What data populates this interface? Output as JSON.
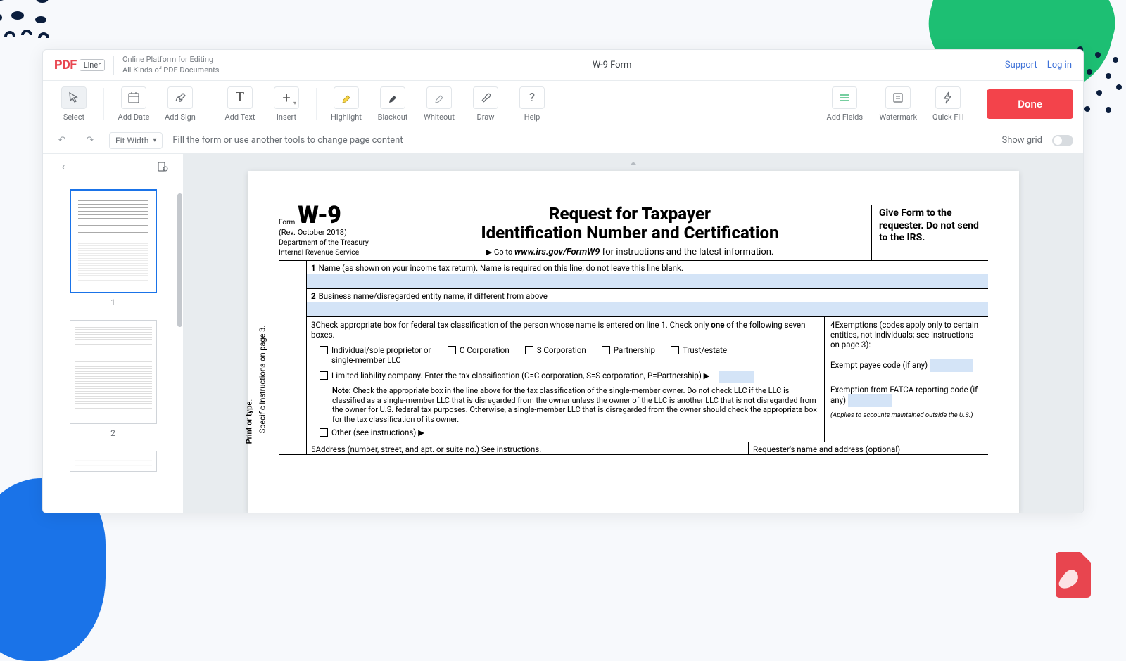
{
  "decor": {
    "blob_dots": "·"
  },
  "header": {
    "logo_red": "PDF",
    "logo_liner": "Liner",
    "tagline_l1": "Online Platform for Editing",
    "tagline_l2": "All Kinds of PDF Documents",
    "title": "W-9 Form",
    "support": "Support",
    "login": "Log in"
  },
  "toolbar": {
    "select": "Select",
    "add_date": "Add Date",
    "add_sign": "Add Sign",
    "add_text": "Add Text",
    "insert": "Insert",
    "highlight": "Highlight",
    "blackout": "Blackout",
    "whiteout": "Whiteout",
    "draw": "Draw",
    "help": "Help",
    "add_fields": "Add Fields",
    "watermark": "Watermark",
    "quick_fill": "Quick Fill",
    "done": "Done"
  },
  "secbar": {
    "zoom": "Fit Width",
    "hint": "Fill the form or use another tools to change page content",
    "grid": "Show grid"
  },
  "sidebar": {
    "p1": "1",
    "p2": "2"
  },
  "form": {
    "form_label": "Form",
    "code": "W-9",
    "rev": "(Rev. October 2018)",
    "dept1": "Department of the Treasury",
    "dept2": "Internal Revenue Service",
    "title_l1": "Request for Taxpayer",
    "title_l2": "Identification Number and Certification",
    "sub_prefix": "▶ Go to ",
    "sub_url": "www.irs.gov/FormW9",
    "sub_suffix": " for instructions and the latest information.",
    "right_box": "Give Form to the requester. Do not send to the IRS.",
    "side1": "Print or type.",
    "side2": "Specific Instructions on page 3.",
    "r1": "Name (as shown on your income tax return). Name is required on this line; do not leave this line blank.",
    "r2": "Business name/disregarded entity name, if different from above",
    "r3": "Check appropriate box for federal tax classification of the person whose name is entered on line 1. Check only ",
    "r3_one": "one",
    "r3_tail": " of the following seven boxes.",
    "chk_ind": "Individual/sole proprietor or single-member LLC",
    "chk_ccorp": "C Corporation",
    "chk_scorp": "S Corporation",
    "chk_part": "Partnership",
    "chk_trust": "Trust/estate",
    "chk_llc": "Limited liability company. Enter the tax classification (C=C corporation, S=S corporation, P=Partnership) ▶",
    "note_label": "Note: ",
    "note_body1": "Check the appropriate box in the line above for the tax classification of the single-member owner.  Do not check LLC if the LLC is classified as a single-member LLC that is disregarded from the owner unless the owner of the LLC is another LLC that is ",
    "note_not": "not",
    "note_body2": " disregarded from the owner for U.S. federal tax purposes. Otherwise, a single-member LLC that is disregarded from the owner should check the appropriate box for the tax classification of its owner.",
    "chk_other": "Other (see instructions) ▶",
    "r4_head": "Exemptions (codes apply only to certain entities, not individuals; see instructions on page 3):",
    "r4_payee": "Exempt payee code (if any)",
    "r4_fatca": "Exemption from FATCA reporting code (if any)",
    "r4_note": "(Applies to accounts maintained outside the U.S.)",
    "r5_left": "Address (number, street, and apt. or suite no.) See instructions.",
    "r5_right": "Requester's name and address (optional)"
  }
}
